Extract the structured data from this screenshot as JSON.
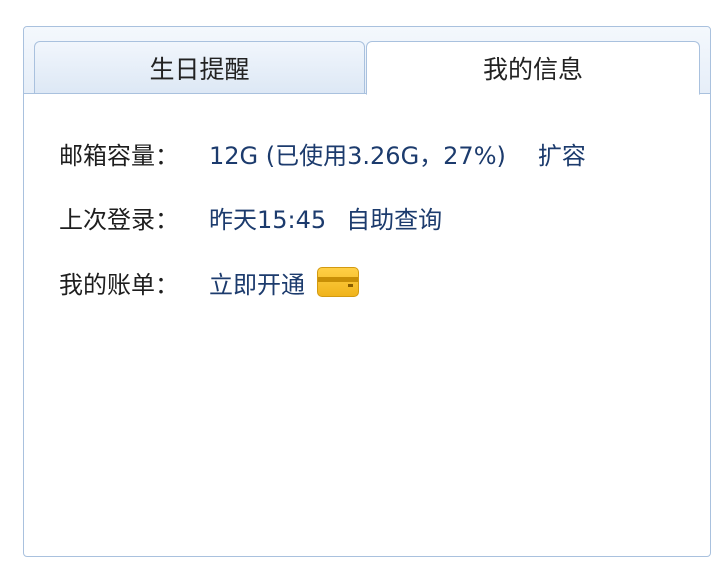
{
  "tabs": [
    {
      "label": "生日提醒",
      "active": false
    },
    {
      "label": "我的信息",
      "active": true
    }
  ],
  "info": {
    "storage": {
      "label": "邮箱容量：",
      "value": "12G (已使用3.26G，27%)",
      "action": "扩容"
    },
    "last_login": {
      "label": "上次登录：",
      "value": "昨天15:45",
      "action": "自助查询"
    },
    "bill": {
      "label": "我的账单：",
      "action": "立即开通",
      "icon": "card-icon"
    }
  },
  "colors": {
    "border": "#a9c1de",
    "link": "#1c3b6d",
    "text": "#1e1e1e"
  }
}
